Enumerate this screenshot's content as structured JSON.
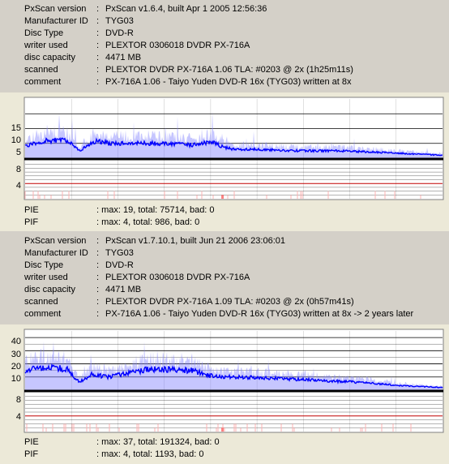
{
  "scans": [
    {
      "info": [
        {
          "label": "PxScan version",
          "value": "PxScan v1.6.4, built Apr  1 2005 12:56:36"
        },
        {
          "label": "Manufacturer ID",
          "value": "TYG03"
        },
        {
          "label": "Disc Type",
          "value": "DVD-R"
        },
        {
          "label": "writer used",
          "value": "PLEXTOR 0306018 DVDR PX-716A"
        },
        {
          "label": "disc capacity",
          "value": "4471 MB"
        },
        {
          "label": "scanned",
          "value": "PLEXTOR DVDR PX-716A 1.06 TLA: #0203 @ 2x (1h25m11s)"
        },
        {
          "label": "comment",
          "value": "PX-716A 1.06 - Taiyo Yuden DVD-R 16x (TYG03) written at 8x"
        }
      ],
      "pie_ticks": [
        "15",
        "10",
        "5"
      ],
      "pif_ticks": [
        "8",
        "4"
      ],
      "stats": [
        {
          "label": "PIE",
          "value": ": max: 19, total: 75714, bad: 0"
        },
        {
          "label": "PIF",
          "value": ": max: 4, total: 986, bad: 0"
        }
      ]
    },
    {
      "info": [
        {
          "label": "PxScan version",
          "value": "PxScan v1.7.10.1, built Jun 21 2006 23:06:01"
        },
        {
          "label": "Manufacturer ID",
          "value": "TYG03"
        },
        {
          "label": "Disc Type",
          "value": "DVD-R"
        },
        {
          "label": "writer used",
          "value": "PLEXTOR 0306018 DVDR PX-716A"
        },
        {
          "label": "disc capacity",
          "value": "4471 MB"
        },
        {
          "label": "scanned",
          "value": "PLEXTOR DVDR PX-716A 1.09 TLA: #0203 @ 2x (0h57m41s)"
        },
        {
          "label": "comment",
          "value": "PX-716A 1.06 - Taiyo Yuden DVD-R 16x (TYG03) written at 8x -> 2 years later"
        }
      ],
      "pie_ticks": [
        "40",
        "30",
        "20",
        "10"
      ],
      "pif_ticks": [
        "8",
        "4"
      ],
      "stats": [
        {
          "label": "PIE",
          "value": ": max: 37, total: 191324, bad: 0"
        },
        {
          "label": "PIF",
          "value": ": max: 4, total: 1193, bad: 0"
        }
      ]
    }
  ],
  "colors": {
    "pie_line": "#0000ff",
    "pie_fill": "#8080ff",
    "pif_spike": "#ffb0b0",
    "pif_limit": "#c00000",
    "grid": "#000000",
    "chart_bg": "#ffffff",
    "panel_bg": "#d4d0c8",
    "stats_bg": "#ece9d8"
  },
  "chart_data": [
    {
      "type": "area",
      "title": "",
      "series": [
        {
          "name": "PIE",
          "levels": {
            "x_fraction": [
              0,
              0.05,
              0.1,
              0.13,
              0.17,
              0.2,
              0.3,
              0.4,
              0.45,
              0.47,
              0.5,
              0.55,
              0.65,
              0.75,
              0.85,
              0.92,
              1.0
            ],
            "y": [
              4,
              6,
              6,
              2.5,
              6,
              5,
              5,
              4.5,
              5.5,
              4,
              3,
              3,
              2.5,
              2.5,
              2,
              1.5,
              1
            ]
          }
        }
      ],
      "pie_axis": {
        "ticks": [
          5,
          10,
          15
        ],
        "ylim": [
          0,
          20
        ]
      },
      "pif_axis": {
        "ticks": [
          4,
          8
        ],
        "ylim": [
          0,
          10
        ],
        "limit": 4
      },
      "pie_max": 19,
      "pif_max": 4,
      "grid": true
    },
    {
      "type": "area",
      "title": "",
      "series": [
        {
          "name": "PIE",
          "levels": {
            "x_fraction": [
              0,
              0.05,
              0.1,
              0.13,
              0.16,
              0.2,
              0.3,
              0.4,
              0.44,
              0.5,
              0.6,
              0.7,
              0.8,
              0.9,
              1.0
            ],
            "y": [
              15,
              18,
              16,
              6,
              12,
              10,
              16,
              15,
              11,
              10,
              9,
              7.5,
              6,
              3.5,
              2
            ]
          }
        }
      ],
      "pie_axis": {
        "ticks": [
          10,
          20,
          30,
          40
        ],
        "ylim": [
          0,
          45
        ]
      },
      "pif_axis": {
        "ticks": [
          4,
          8
        ],
        "ylim": [
          0,
          10
        ],
        "limit": 4
      },
      "pie_max": 37,
      "pif_max": 4,
      "grid": true
    }
  ]
}
